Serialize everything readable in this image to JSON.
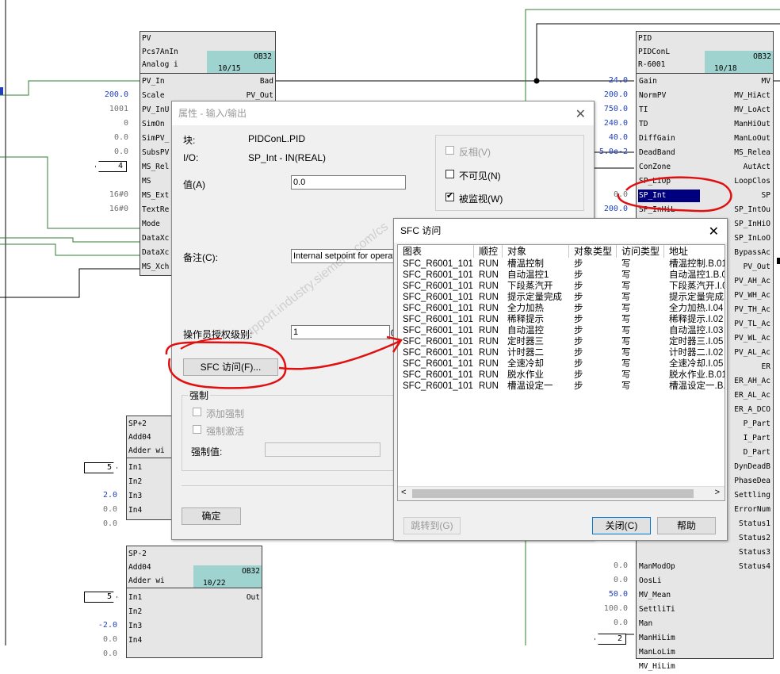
{
  "pv_block": {
    "title": "PV",
    "type": "Pcs7AnIn",
    "desc": "Analog i",
    "ob": "OB32",
    "seq": "10/15",
    "inputs": [
      "PV_In",
      "Scale",
      "PV_InU",
      "SimOn",
      "SimPV_",
      "SubsPV",
      "MS_Rel",
      "MS",
      "MS_Ext",
      "TextRe",
      "Mode",
      "DataXc",
      "DataXc",
      "MS_Xch"
    ],
    "outputs": [
      "Bad",
      "PV_Out"
    ],
    "values": [
      "",
      "200.0",
      "1001",
      "0",
      "0.0",
      "0.0",
      "",
      "",
      "16#0",
      "16#0",
      "",
      "",
      "",
      ""
    ],
    "ms_rel_tag": "4"
  },
  "pid_block": {
    "title": "PID",
    "type": "PIDConL",
    "desc": "R-6001",
    "ob": "OB32",
    "seq": "10/18",
    "inputs": [
      "Gain",
      "NormPV",
      "TI",
      "TD",
      "DiffGain",
      "DeadBand",
      "ConZone",
      "SP_LiOp",
      "SP_Int",
      "SP_InHiL",
      "",
      "",
      "",
      "",
      "",
      "",
      "",
      "",
      "",
      "",
      "",
      "",
      "",
      "",
      "",
      "",
      "",
      "",
      "",
      "",
      "",
      "",
      "",
      "",
      "ManModOp",
      "OosLi",
      "MV_Mean",
      "SettliTi",
      "Man",
      "ManHiLim",
      "ManLoLim",
      "MV_HiLim"
    ],
    "outputs": [
      "MV",
      "MV_HiAct",
      "MV_LoAct",
      "ManHiOut",
      "ManLoOut",
      "MS_Relea",
      "AutAct",
      "LoopClos",
      "SP",
      "SP_IntOu",
      "SP_InHiO",
      "SP_InLoO",
      "BypassAc",
      "PV_Out",
      "PV_AH_Ac",
      "PV_WH_Ac",
      "PV_TH_Ac",
      "PV_TL_Ac",
      "PV_WL_Ac",
      "PV_AL_Ac",
      "ER",
      "ER_AH_Ac",
      "ER_AL_Ac",
      "ER_A_DCO",
      "P_Part",
      "I_Part",
      "D_Part",
      "DynDeadB",
      "PhaseDea",
      "Settling",
      "ErrorNum",
      "Status1",
      "Status2",
      "Status3",
      "Status4"
    ],
    "values": [
      "24.0",
      "200.0",
      "750.0",
      "240.0",
      "40.0",
      "5.0e-2",
      "",
      "",
      "0.0",
      "200.0"
    ],
    "bottom_values": [
      "",
      "",
      "0.0",
      "0.0",
      "50.0",
      "100.0",
      "0.0",
      ""
    ],
    "mv_hilim_tag": "2"
  },
  "sp2_top": {
    "title": "SP+2",
    "type": "Add04",
    "desc": "Adder wi",
    "inputs": [
      "In1",
      "In2",
      "In3",
      "In4"
    ],
    "values": [
      "",
      "2.0",
      "0.0",
      "0.0"
    ],
    "tag": "5"
  },
  "sp2": {
    "title": "SP-2",
    "type": "Add04",
    "desc": "Adder wi",
    "ob": "OB32",
    "seq": "10/22",
    "inputs": [
      "In1",
      "In2",
      "In3",
      "In4"
    ],
    "output": "Out",
    "values": [
      "",
      "-2.0",
      "0.0",
      "0.0"
    ],
    "tag": "5"
  },
  "props_dialog": {
    "title": "属性 - 输入/输出",
    "block_label": "块:",
    "block_value": "PIDConL.PID",
    "io_label": "I/O:",
    "io_value": "SP_Int - IN(REAL)",
    "value_label": "值(A)",
    "value": "0.0",
    "comment_label": "备注(C):",
    "comment": "Internal setpoint for operati",
    "auth_label": "操作员授权级别:",
    "auth_value": "1",
    "auth_extra": "0",
    "sfc_button": "SFC 访问(F)...",
    "force_group": "强制",
    "force_add": "添加强制",
    "force_activate": "强制激活",
    "force_value_label": "强制值:",
    "check_invert": "反相(V)",
    "check_invisible": "不可见(N)",
    "check_monitor": "被监视(W)",
    "ok_button": "确定",
    "side_char": "I"
  },
  "sfc_dialog": {
    "title": "SFC 访问",
    "columns": [
      "图表",
      "顺控",
      "对象",
      "对象类型",
      "访问类型",
      "地址"
    ],
    "rows": [
      [
        "SFC_R6001_101",
        "RUN",
        "槽温控制",
        "步",
        "写",
        "槽温控制.B.01"
      ],
      [
        "SFC_R6001_101",
        "RUN",
        "自动温控1",
        "步",
        "写",
        "自动温控1.B.01"
      ],
      [
        "SFC_R6001_101",
        "RUN",
        "下段蒸汽开",
        "步",
        "写",
        "下段蒸汽开.I.0"
      ],
      [
        "SFC_R6001_101",
        "RUN",
        "提示定量完成",
        "步",
        "写",
        "提示定量完成."
      ],
      [
        "SFC_R6001_101",
        "RUN",
        "全力加热",
        "步",
        "写",
        "全力加热.I.04"
      ],
      [
        "SFC_R6001_101",
        "RUN",
        "稀释提示",
        "步",
        "写",
        "稀释提示.I.02"
      ],
      [
        "SFC_R6001_101",
        "RUN",
        "自动温控",
        "步",
        "写",
        "自动温控.I.03"
      ],
      [
        "SFC_R6001_101",
        "RUN",
        "定时器三",
        "步",
        "写",
        "定时器三.I.05"
      ],
      [
        "SFC_R6001_101",
        "RUN",
        "计时器二",
        "步",
        "写",
        "计时器二.I.02"
      ],
      [
        "SFC_R6001_101",
        "RUN",
        "全速冷却",
        "步",
        "写",
        "全速冷却.I.05"
      ],
      [
        "SFC_R6001_101",
        "RUN",
        "脱水作业",
        "步",
        "写",
        "脱水作业.B.01"
      ],
      [
        "SFC_R6001_101",
        "RUN",
        "槽温设定一",
        "步",
        "写",
        "槽温设定一.B.0"
      ]
    ],
    "goto_button": "跳转到(G)",
    "close_button": "关闭(C)",
    "help_button": "帮助"
  },
  "watermark": "support.industry.siemens.com/cs",
  "colors": {
    "block_bg": "#e6e6e6",
    "ob_teal": "#9fd3cf",
    "annotation_red": "#e01010",
    "link_green": "#2e7d32",
    "select_navy": "#00007f"
  }
}
